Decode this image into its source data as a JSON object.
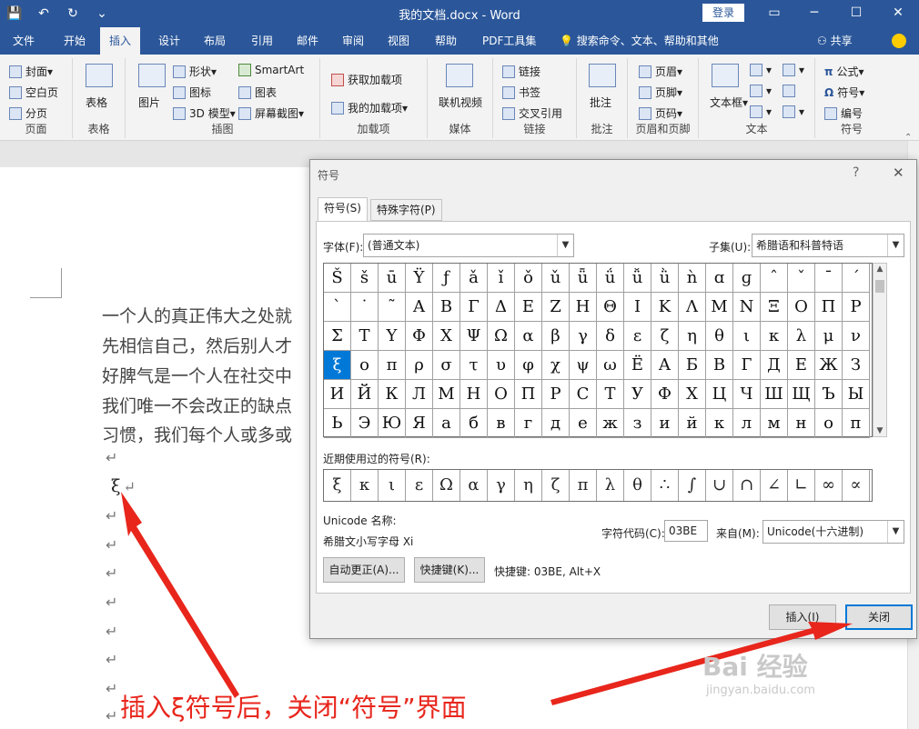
{
  "titlebar": {
    "title": "我的文档.docx  -  Word",
    "login": "登录",
    "qat": [
      "💾",
      "↶",
      "↻",
      "⌄"
    ]
  },
  "tabs": [
    "文件",
    "开始",
    "插入",
    "设计",
    "布局",
    "引用",
    "邮件",
    "审阅",
    "视图",
    "帮助",
    "PDF工具集"
  ],
  "active_tab": "插入",
  "search": "搜索命令、文本、帮助和其他",
  "share": "共享",
  "ribbon": {
    "page": {
      "label": "页面",
      "items": [
        "封面",
        "空白页",
        "分页"
      ]
    },
    "table": {
      "label": "表格",
      "button": "表格"
    },
    "illus": {
      "label": "插图",
      "picture": "图片",
      "items": [
        "形状",
        "图标",
        "3D 模型",
        "SmartArt",
        "图表",
        "屏幕截图"
      ]
    },
    "addins": {
      "label": "加载项",
      "items": [
        "获取加载项",
        "我的加载项"
      ]
    },
    "media": {
      "label": "媒体",
      "button": "联机视频"
    },
    "links": {
      "label": "链接",
      "items": [
        "链接",
        "书签",
        "交叉引用"
      ]
    },
    "comment": {
      "label": "批注",
      "button": "批注"
    },
    "hf": {
      "label": "页眉和页脚",
      "items": [
        "页眉",
        "页脚",
        "页码"
      ]
    },
    "text": {
      "label": "文本",
      "button": "文本框"
    },
    "symbols": {
      "label": "符号",
      "items": [
        "公式",
        "符号",
        "编号"
      ]
    }
  },
  "document": {
    "lines": [
      "一个人的真正伟大之处就",
      "先相信自己，然后别人才",
      "好脾气是一个人在社交中",
      "我们唯一不会改正的缺点",
      "习惯，我们每个人或多或"
    ],
    "para_mark": "↵",
    "inserted": "ξ"
  },
  "dialog": {
    "title": "符号",
    "help": "?",
    "close_x": "✕",
    "tabs": [
      "符号(S)",
      "特殊字符(P)"
    ],
    "font_label": "字体(F):",
    "font_value": "(普通文本)",
    "subset_label": "子集(U):",
    "subset_value": "希腊语和科普特语",
    "symbols": [
      [
        "Š",
        "š",
        "ū",
        "Ÿ",
        "ƒ",
        "ǎ",
        "ǐ",
        "ǒ",
        "ǔ",
        "ǖ",
        "ǘ",
        "ǚ",
        "ǜ",
        "ǹ",
        "ɑ",
        "ɡ",
        "ˆ",
        "ˇ",
        "ˉ",
        "ˊ"
      ],
      [
        "ˋ",
        "˙",
        "˜",
        "Α",
        "Β",
        "Γ",
        "Δ",
        "Ε",
        "Ζ",
        "Η",
        "Θ",
        "Ι",
        "Κ",
        "Λ",
        "Μ",
        "Ν",
        "Ξ",
        "Ο",
        "Π",
        "Ρ"
      ],
      [
        "Σ",
        "Τ",
        "Υ",
        "Φ",
        "Χ",
        "Ψ",
        "Ω",
        "α",
        "β",
        "γ",
        "δ",
        "ε",
        "ζ",
        "η",
        "θ",
        "ι",
        "κ",
        "λ",
        "μ",
        "ν"
      ],
      [
        "ξ",
        "ο",
        "π",
        "ρ",
        "σ",
        "τ",
        "υ",
        "φ",
        "χ",
        "ψ",
        "ω",
        "Ё",
        "А",
        "Б",
        "В",
        "Г",
        "Д",
        "Е",
        "Ж",
        "З"
      ],
      [
        "И",
        "Й",
        "К",
        "Л",
        "М",
        "Н",
        "О",
        "П",
        "Р",
        "С",
        "Т",
        "У",
        "Ф",
        "Х",
        "Ц",
        "Ч",
        "Ш",
        "Щ",
        "Ъ",
        "Ы"
      ],
      [
        "Ь",
        "Э",
        "Ю",
        "Я",
        "а",
        "б",
        "в",
        "г",
        "д",
        "е",
        "ж",
        "з",
        "и",
        "й",
        "к",
        "л",
        "м",
        "н",
        "о",
        "п"
      ]
    ],
    "selected_symbol": "ξ",
    "recent_label": "近期使用过的符号(R):",
    "recent": [
      "ξ",
      "κ",
      "ι",
      "ε",
      "Ω",
      "α",
      "γ",
      "η",
      "ζ",
      "π",
      "λ",
      "θ",
      "∴",
      "∫",
      "∪",
      "∩",
      "∠",
      "∟",
      "∞",
      "∝"
    ],
    "unicode_name_label": "Unicode 名称:",
    "unicode_name": "希腊文小写字母 Xi",
    "code_label": "字符代码(C):",
    "code_value": "03BE",
    "from_label": "来自(M):",
    "from_value": "Unicode(十六进制)",
    "autocorrect_btn": "自动更正(A)...",
    "shortcut_btn": "快捷键(K)...",
    "shortcut_text": "快捷键: 03BE, Alt+X",
    "insert_btn": "插入(I)",
    "close_btn": "关闭"
  },
  "annotation": "插入ξ符号后，关闭“符号”界面",
  "watermark": {
    "main": "Bai 经验",
    "sub": "jingyan.baidu.com"
  },
  "colors": {
    "word_blue": "#2b579a",
    "selection": "#0078d7",
    "annotation_red": "#e8261c"
  }
}
